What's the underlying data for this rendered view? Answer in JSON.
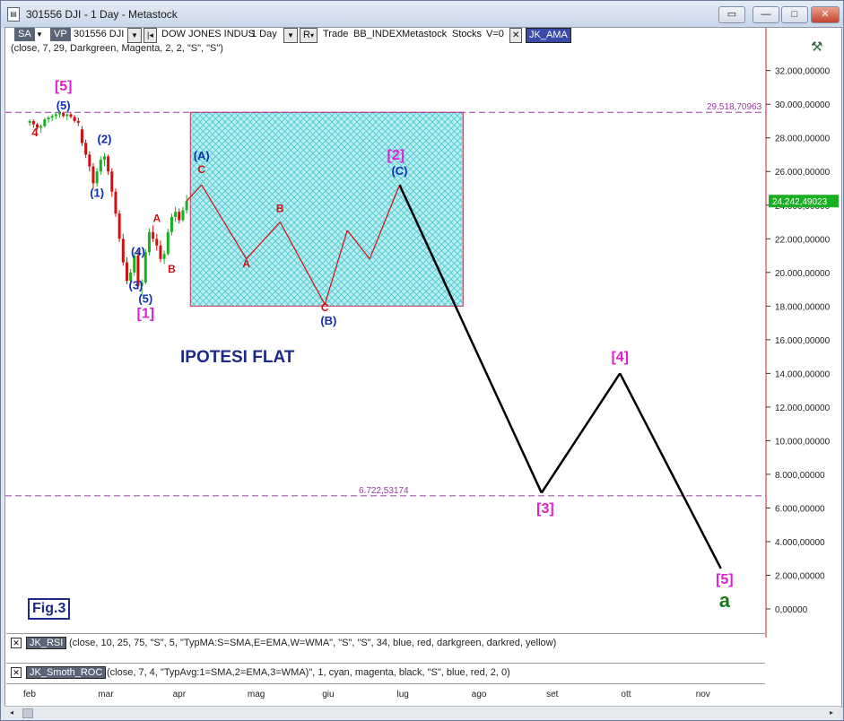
{
  "window": {
    "title": "301556 DJI - 1 Day - Metastock",
    "buttons": [
      "▭",
      "—",
      "□",
      "✕"
    ]
  },
  "toolbar": {
    "sa": "SA",
    "vp": "VP",
    "symbol": "301556 DJI",
    "security": "DOW JONES INDUS",
    "period": "1 Day",
    "r": "R",
    "trade": "Trade",
    "source": "BB_INDEX",
    "source_name": "Metastock",
    "stocks": "Stocks",
    "v": "V=0",
    "indicator": "JK_AMA"
  },
  "formula_line": "(close, 7, 29, Darkgreen, Magenta, 2, 2, \"S\", \"S\")",
  "rsi_panel": {
    "name": "JK_RSI",
    "text": "(close, 10, 25, 75, \"S\", 5, \"TypMA:S=SMA,E=EMA,W=WMA\", \"S\", \"S\", 34, blue, red, darkgreen, darkred, yellow)"
  },
  "roc_panel": {
    "name": "JK_Smoth_ROC",
    "text": "(close, 7, 4, \"TypAvg:1=SMA,2=EMA,3=WMA)\", 1, cyan, magenta, black, \"S\", blue, red, 2, 0)"
  },
  "fig_label": "Fig.3",
  "flat_label": "IPOTESI FLAT",
  "chart_data": {
    "type": "line",
    "title": "",
    "xlabel": "",
    "ylabel": "",
    "ylim": [
      -1000,
      34000
    ],
    "yticks": [
      0,
      2000,
      4000,
      6000,
      8000,
      10000,
      12000,
      14000,
      16000,
      18000,
      20000,
      22000,
      24000,
      26000,
      28000,
      30000,
      32000
    ],
    "ytick_labels": [
      "0,00000",
      "2.000,00000",
      "4.000,00000",
      "6.000,00000",
      "8.000,00000",
      "10.000,00000",
      "12.000,00000",
      "14.000,00000",
      "16.000,00000",
      "18.000,00000",
      "20.000,00000",
      "22.000,00000",
      "24.000,00000",
      "26.000,00000",
      "28.000,00000",
      "30.000,00000",
      "32.000,00000"
    ],
    "months": [
      "feb",
      "mar",
      "apr",
      "mag",
      "giu",
      "lug",
      "ago",
      "set",
      "ott",
      "nov"
    ],
    "last_price": 24242.49023,
    "last_price_label": "24.242,49023",
    "hlines": [
      {
        "value": 29518.70963,
        "label": "29.518,70963"
      },
      {
        "value": 6722.53174,
        "label": "6.722,53174"
      }
    ],
    "flat_box": {
      "x_from": 2.2,
      "x_to": 5.85,
      "y_low": 18000,
      "y_high": 29518.70963
    },
    "candles": [
      [
        0.05,
        28900,
        29100,
        28700,
        29000
      ],
      [
        0.1,
        29000,
        29100,
        28600,
        28800
      ],
      [
        0.15,
        28800,
        28900,
        28500,
        28600
      ],
      [
        0.2,
        28600,
        28800,
        28300,
        28700
      ],
      [
        0.25,
        28700,
        29200,
        28600,
        29100
      ],
      [
        0.3,
        29100,
        29300,
        28900,
        29200
      ],
      [
        0.35,
        29200,
        29400,
        29000,
        29300
      ],
      [
        0.4,
        29300,
        29500,
        29100,
        29400
      ],
      [
        0.45,
        29400,
        29600,
        29200,
        29500
      ],
      [
        0.5,
        29500,
        29550,
        29200,
        29300
      ],
      [
        0.55,
        29300,
        29450,
        29050,
        29400
      ],
      [
        0.6,
        29400,
        29500,
        29150,
        29250
      ],
      [
        0.65,
        29250,
        29350,
        28900,
        29000
      ],
      [
        0.7,
        29000,
        29200,
        28700,
        28900
      ],
      [
        0.75,
        28500,
        28700,
        27500,
        27700
      ],
      [
        0.8,
        27700,
        27900,
        26800,
        27000
      ],
      [
        0.85,
        27000,
        27200,
        26000,
        26300
      ],
      [
        0.9,
        26300,
        26500,
        25000,
        25300
      ],
      [
        0.95,
        25300,
        26200,
        25100,
        26000
      ],
      [
        1.0,
        26000,
        26900,
        25800,
        26700
      ],
      [
        1.05,
        26700,
        27100,
        26300,
        26900
      ],
      [
        1.1,
        26900,
        27000,
        25800,
        26000
      ],
      [
        1.15,
        26000,
        26200,
        24500,
        24800
      ],
      [
        1.2,
        24800,
        25000,
        23300,
        23500
      ],
      [
        1.25,
        23500,
        23700,
        21800,
        22000
      ],
      [
        1.3,
        22000,
        22300,
        20400,
        20600
      ],
      [
        1.35,
        20600,
        20900,
        19300,
        19500
      ],
      [
        1.4,
        19500,
        20200,
        19200,
        20000
      ],
      [
        1.45,
        20000,
        21200,
        19800,
        21000
      ],
      [
        1.5,
        21000,
        21300,
        19000,
        19200
      ],
      [
        1.55,
        19200,
        19600,
        18600,
        19400
      ],
      [
        1.6,
        19400,
        21400,
        19300,
        21200
      ],
      [
        1.65,
        21200,
        22600,
        21000,
        22400
      ],
      [
        1.7,
        22400,
        22800,
        21800,
        22000
      ],
      [
        1.75,
        22000,
        22300,
        21300,
        21600
      ],
      [
        1.8,
        21600,
        21900,
        20600,
        20800
      ],
      [
        1.85,
        20800,
        21300,
        20500,
        21100
      ],
      [
        1.9,
        21100,
        22600,
        21000,
        22400
      ],
      [
        1.95,
        22400,
        23500,
        22200,
        23300
      ],
      [
        2.0,
        23300,
        23900,
        23000,
        23600
      ],
      [
        2.05,
        23600,
        23800,
        22900,
        23100
      ],
      [
        2.1,
        23100,
        23900,
        23000,
        23700
      ],
      [
        2.15,
        23700,
        24600,
        23500,
        24242
      ]
    ],
    "series": [
      {
        "name": "",
        "color": "#000000",
        "points": [
          [
            2.15,
            24242
          ],
          [
            2.35,
            25200
          ],
          [
            2.95,
            20800
          ],
          [
            3.4,
            23000
          ],
          [
            4.0,
            18100
          ],
          [
            4.3,
            22500
          ],
          [
            4.6,
            20800
          ],
          [
            5.0,
            25200
          ],
          [
            6.9,
            6900
          ],
          [
            7.95,
            14000
          ],
          [
            9.3,
            2400
          ]
        ]
      }
    ],
    "wave_labels": [
      {
        "text": "[5]",
        "x": 0.5,
        "y": 30800,
        "color": "#e020d0",
        "size": 16
      },
      {
        "text": "(5)",
        "x": 0.5,
        "y": 29700,
        "color": "#1030b0",
        "size": 13
      },
      {
        "text": "4",
        "x": 0.12,
        "y": 28100,
        "color": "#d01010",
        "size": 13
      },
      {
        "text": "(2)",
        "x": 1.05,
        "y": 27700,
        "color": "#1030b0",
        "size": 13
      },
      {
        "text": "(1)",
        "x": 0.95,
        "y": 24500,
        "color": "#1030b0",
        "size": 13
      },
      {
        "text": "(A)",
        "x": 2.35,
        "y": 26700,
        "color": "#1030b0",
        "size": 13
      },
      {
        "text": "C",
        "x": 2.35,
        "y": 25900,
        "color": "#d01010",
        "size": 12
      },
      {
        "text": "A",
        "x": 1.75,
        "y": 23000,
        "color": "#d01010",
        "size": 12
      },
      {
        "text": "(4)",
        "x": 1.5,
        "y": 21000,
        "color": "#1030b0",
        "size": 13
      },
      {
        "text": "B",
        "x": 1.95,
        "y": 20000,
        "color": "#d01010",
        "size": 12
      },
      {
        "text": "(3)",
        "x": 1.47,
        "y": 19000,
        "color": "#1030b0",
        "size": 13
      },
      {
        "text": "(5)",
        "x": 1.6,
        "y": 18200,
        "color": "#1030b0",
        "size": 13
      },
      {
        "text": "[1]",
        "x": 1.6,
        "y": 17300,
        "color": "#e020d0",
        "size": 16
      },
      {
        "text": "B",
        "x": 3.4,
        "y": 23600,
        "color": "#d01010",
        "size": 12
      },
      {
        "text": "A",
        "x": 2.95,
        "y": 20300,
        "color": "#d01010",
        "size": 12
      },
      {
        "text": "C",
        "x": 4.0,
        "y": 17700,
        "color": "#d01010",
        "size": 12
      },
      {
        "text": "(B)",
        "x": 4.05,
        "y": 16900,
        "color": "#1030b0",
        "size": 13
      },
      {
        "text": "[2]",
        "x": 4.95,
        "y": 26700,
        "color": "#e020d0",
        "size": 16
      },
      {
        "text": "(C)",
        "x": 5.0,
        "y": 25800,
        "color": "#1030b0",
        "size": 13
      },
      {
        "text": "[3]",
        "x": 6.95,
        "y": 5700,
        "color": "#e020d0",
        "size": 16
      },
      {
        "text": "[4]",
        "x": 7.95,
        "y": 14700,
        "color": "#e020d0",
        "size": 16
      },
      {
        "text": "[5]",
        "x": 9.35,
        "y": 1500,
        "color": "#e020d0",
        "size": 16
      },
      {
        "text": "a",
        "x": 9.35,
        "y": 100,
        "color": "#1a7a1a",
        "size": 22
      }
    ]
  }
}
